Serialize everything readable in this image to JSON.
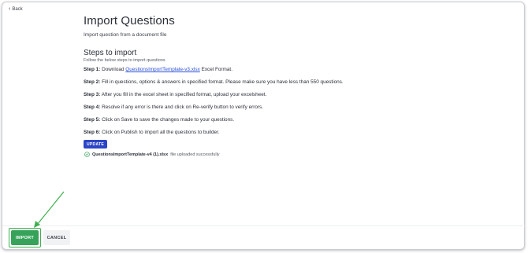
{
  "nav": {
    "back_label": "Back"
  },
  "header": {
    "title": "Import Questions",
    "subtitle": "Import question from a document file"
  },
  "steps_section": {
    "heading": "Steps to import",
    "description": "Follow the below steps to import questions",
    "steps": [
      {
        "label": "Step 1:",
        "before": "Download",
        "link": "QuestionsImportTemplate-v3.xlsx",
        "after": "Excel Format."
      },
      {
        "label": "Step 2:",
        "text": "Fill in questions, options & answers in specified format. Please make sure you have less than 550 questions."
      },
      {
        "label": "Step 3:",
        "text": "After you fill in the excel sheet in specified format, upload your excelsheet."
      },
      {
        "label": "Step 4:",
        "text": "Resolve if any error is there and click on Re-verify button to verify errors."
      },
      {
        "label": "Step 5:",
        "text": "Click on Save to save the changes made to your questions."
      },
      {
        "label": "Step 6:",
        "text": "Click on Publish to import all the questions to builder."
      }
    ],
    "update_label": "UPDATE"
  },
  "upload_status": {
    "filename": "QuestionsImportTemplate-v4 (1).xlsx",
    "message": "file uploaded successfully",
    "icon": "check-circle-icon"
  },
  "footer": {
    "import_label": "IMPORT",
    "cancel_label": "CANCEL"
  },
  "colors": {
    "primary": "#2b45c6",
    "link": "#2b50d6",
    "success": "#37a35a",
    "annotation": "#3fb04f"
  }
}
